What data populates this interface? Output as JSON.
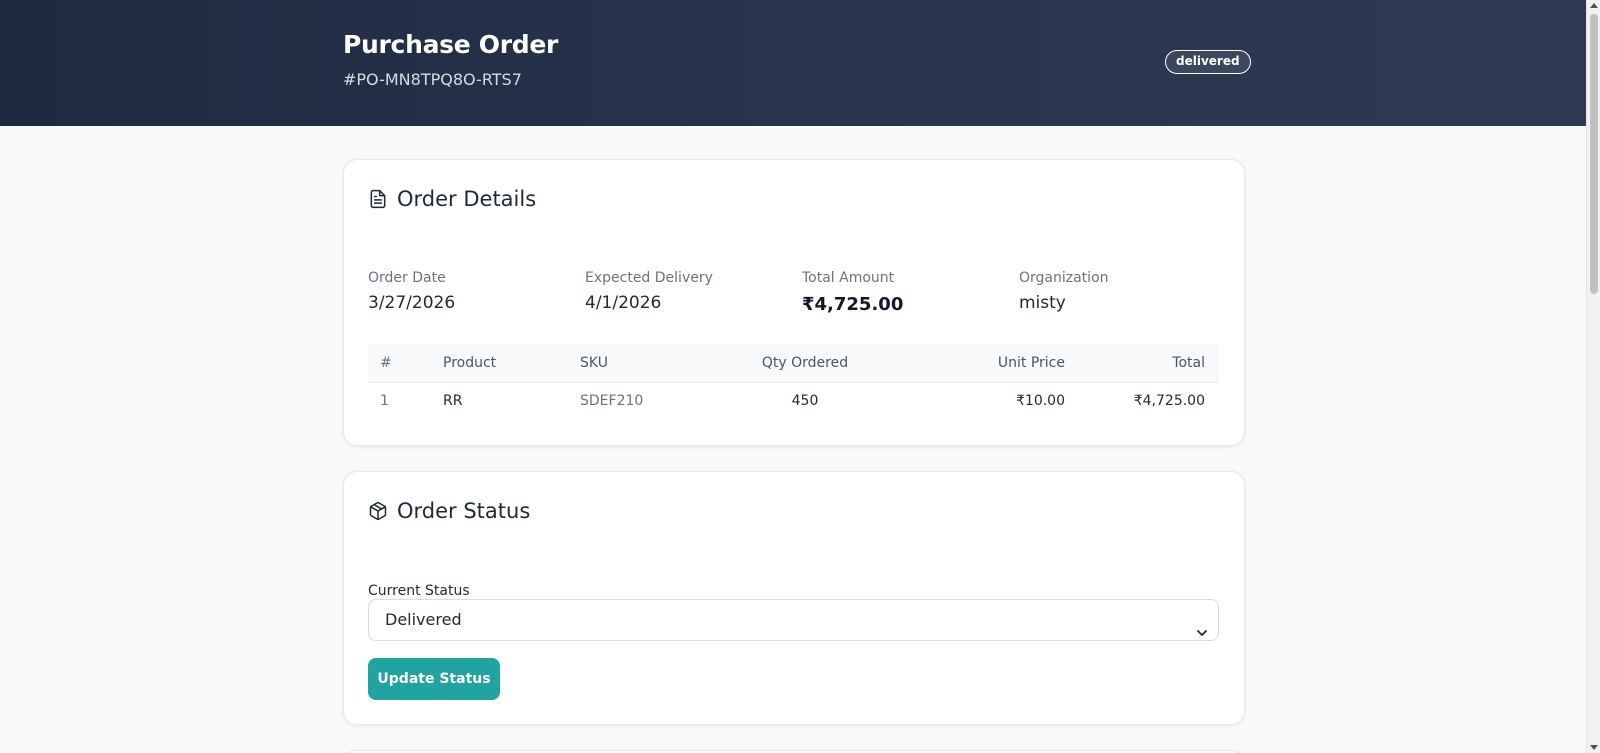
{
  "header": {
    "title": "Purchase Order",
    "order_id": "#PO-MN8TPQ8O-RTS7",
    "status_badge": "delivered"
  },
  "order_details": {
    "heading": "Order Details",
    "icon": "document-icon",
    "fields": {
      "order_date": {
        "label": "Order Date",
        "value": "3/27/2026"
      },
      "expected_delivery": {
        "label": "Expected Delivery",
        "value": "4/1/2026"
      },
      "total_amount": {
        "label": "Total Amount",
        "value": "₹4,725.00"
      },
      "organization": {
        "label": "Organization",
        "value": "misty"
      }
    },
    "table": {
      "columns": [
        "#",
        "Product",
        "SKU",
        "Qty Ordered",
        "Unit Price",
        "Total"
      ],
      "rows": [
        {
          "index": "1",
          "product": "RR",
          "sku": "SDEF210",
          "qty": "450",
          "unit_price": "₹10.00",
          "total": "₹4,725.00"
        }
      ]
    }
  },
  "order_status": {
    "heading": "Order Status",
    "icon": "box-icon",
    "field_label": "Current Status",
    "selected_value": "Delivered",
    "update_button": "Update Status"
  },
  "colors": {
    "header_bg": "#1e2a3f",
    "accent": "#21a3a0",
    "page_bg": "#f7f9fa"
  }
}
